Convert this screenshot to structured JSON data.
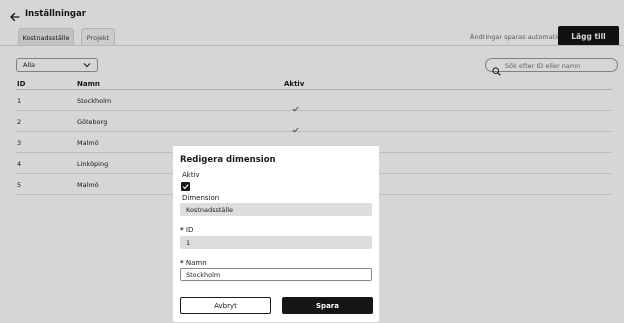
{
  "header": {
    "title": "Inställningar",
    "back_icon": "arrow-left-icon"
  },
  "tabs": [
    {
      "label": "Kostnadsställe",
      "active": true
    },
    {
      "label": "Projekt",
      "active": false
    }
  ],
  "toolbar": {
    "autosave_text": "Ändringar sparas automatiskt",
    "add_label": "Lägg till"
  },
  "filter": {
    "selected": "Alla"
  },
  "search": {
    "placeholder": "Sök efter ID eller namn"
  },
  "table": {
    "columns": [
      "ID",
      "Namn",
      "Aktiv"
    ],
    "rows": [
      {
        "id": "1",
        "name": "Stockholm",
        "active": true
      },
      {
        "id": "2",
        "name": "Göteborg",
        "active": true
      },
      {
        "id": "3",
        "name": "Malmö",
        "active": true
      },
      {
        "id": "4",
        "name": "Linköping",
        "active": true
      },
      {
        "id": "5",
        "name": "Malmö",
        "active": true
      }
    ]
  },
  "modal": {
    "title": "Redigera dimension",
    "active_label": "Aktiv",
    "active_checked": true,
    "dimension_label": "Dimension",
    "dimension_value": "Kostnadsställe",
    "required_marker": "*",
    "id_label": "ID",
    "id_value": "1",
    "name_label": "Namn",
    "name_value": "Stockholm",
    "cancel_label": "Avbryt",
    "save_label": "Spara"
  },
  "colors": {
    "primary": "#151515",
    "overlay": "rgba(0,0,0,0.16)",
    "disabled_field": "#dddddd"
  }
}
